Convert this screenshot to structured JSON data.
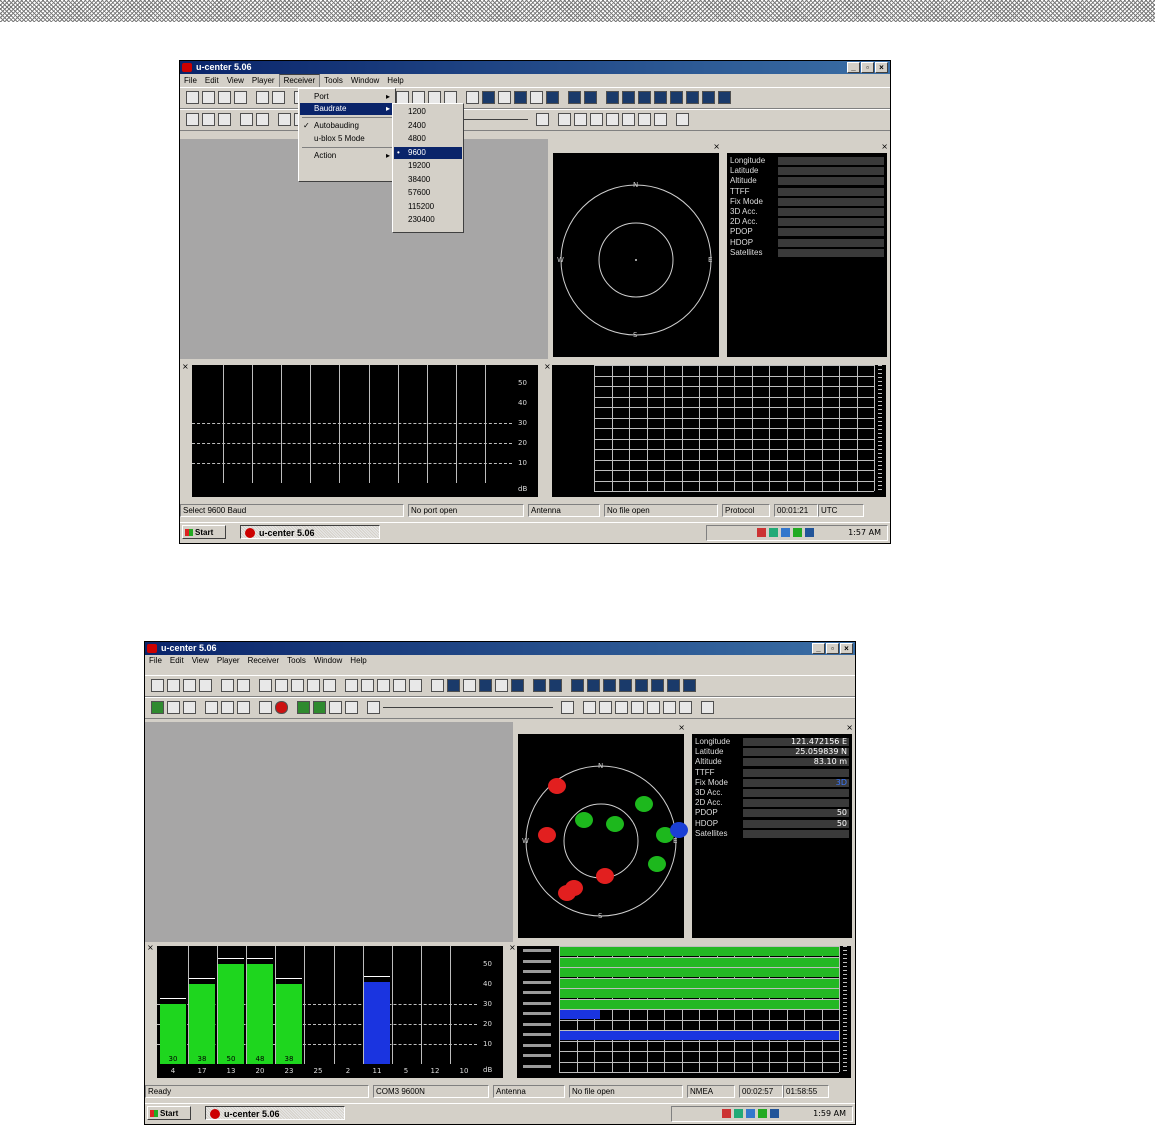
{
  "top": {
    "title": "u-center 5.06",
    "menu": [
      "File",
      "Edit",
      "View",
      "Player",
      "Receiver",
      "Tools",
      "Window",
      "Help"
    ],
    "receiver_menu": [
      {
        "label": "Port",
        "arrow": true
      },
      {
        "label": "Baudrate",
        "arrow": true,
        "selected": true
      },
      {
        "label": "Autobauding",
        "checked": true
      },
      {
        "label": "u-blox 5 Mode"
      },
      {
        "label": "Action",
        "arrow": true
      }
    ],
    "baud_menu": [
      "1200",
      "2400",
      "4800",
      "9600",
      "19200",
      "38400",
      "57600",
      "115200",
      "230400"
    ],
    "baud_selected_index": 3,
    "compass": {
      "n": "N",
      "s": "S",
      "e": "E",
      "w": "W"
    },
    "info_labels": [
      "Longitude",
      "Latitude",
      "Altitude",
      "TTFF",
      "Fix Mode",
      "3D Acc.",
      "2D Acc.",
      "PDOP",
      "HDOP",
      "Satellites"
    ],
    "snr_axis": [
      "50",
      "40",
      "30",
      "20",
      "10",
      "dB"
    ],
    "status": [
      "Select 9600 Baud",
      "No port open",
      "Antenna",
      "No file open",
      "Protocol",
      "00:01:21",
      "UTC"
    ],
    "start_label": "Start",
    "task_label": "u-center 5.06",
    "clock": "1:57 AM"
  },
  "bottom": {
    "title": "u-center 5.06",
    "menu": [
      "File",
      "Edit",
      "View",
      "Player",
      "Receiver",
      "Tools",
      "Window",
      "Help"
    ],
    "compass": {
      "n": "N",
      "s": "S",
      "e": "E",
      "w": "W"
    },
    "info_labels": [
      "Longitude",
      "Latitude",
      "Altitude",
      "TTFF",
      "Fix Mode",
      "3D Acc.",
      "2D Acc.",
      "PDOP",
      "HDOP",
      "Satellites"
    ],
    "info_values": [
      "121.472156 E",
      "25.059839 N",
      "83.10 m",
      "",
      "3D",
      "",
      "",
      "50",
      "50",
      ""
    ],
    "info_value_colors": [
      "#ffffff",
      "#ffffff",
      "#ffffff",
      "#ffffff",
      "#3a78ff",
      "#ffffff",
      "#ffffff",
      "#ffffff",
      "#ffffff",
      "#ffffff"
    ],
    "sky_sats": [
      {
        "id": "",
        "color": "r",
        "at": "a"
      },
      {
        "id": "",
        "color": "g",
        "at": "b"
      },
      {
        "id": "",
        "color": "g",
        "at": "c"
      },
      {
        "id": "",
        "color": "g",
        "at": "d"
      },
      {
        "id": "",
        "color": "r",
        "at": "e"
      },
      {
        "id": "",
        "color": "g",
        "at": "f"
      },
      {
        "id": "",
        "color": "b",
        "at": "g"
      },
      {
        "id": "",
        "color": "g",
        "at": "h"
      },
      {
        "id": "",
        "color": "r",
        "at": "i"
      },
      {
        "id": "",
        "color": "r",
        "at": "j"
      },
      {
        "id": "",
        "color": "r",
        "at": "k"
      }
    ],
    "snr_axis": [
      "50",
      "40",
      "30",
      "20",
      "10",
      "dB"
    ],
    "snr_bars": [
      {
        "sv": "4",
        "value": 30,
        "label": "30",
        "color": "#1ed61e"
      },
      {
        "sv": "17",
        "value": 40,
        "label": "38",
        "color": "#1ed61e"
      },
      {
        "sv": "13",
        "value": 50,
        "label": "50",
        "color": "#1ed61e"
      },
      {
        "sv": "20",
        "value": 50,
        "label": "48",
        "color": "#1ed61e"
      },
      {
        "sv": "23",
        "value": 40,
        "label": "38",
        "color": "#1ed61e"
      },
      {
        "sv": "25",
        "value": 0,
        "label": "",
        "color": "#1ed61e"
      },
      {
        "sv": "2",
        "value": 0,
        "label": "",
        "color": "#1ed61e"
      },
      {
        "sv": "11",
        "value": 41,
        "label": "",
        "color": "#1a34e0"
      },
      {
        "sv": "5",
        "value": 0,
        "label": "",
        "color": "#1ed61e"
      },
      {
        "sv": "12",
        "value": 0,
        "label": "",
        "color": "#1ed61e"
      },
      {
        "sv": "10",
        "value": 0,
        "label": "",
        "color": "#1ed61e"
      }
    ],
    "status": [
      "Ready",
      "COM3 9600N",
      "Antenna",
      "No file open",
      "NMEA",
      "00:02:57",
      "01:58:55"
    ],
    "start_label": "Start",
    "task_label": "u-center 5.06",
    "clock": "1:59 AM"
  }
}
